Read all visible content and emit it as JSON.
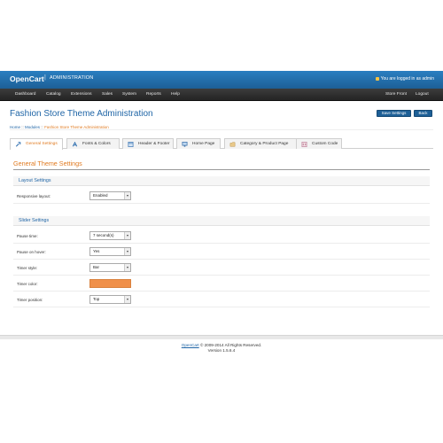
{
  "header": {
    "brand": "OpenCart",
    "separator": "|",
    "admin_label": "ADMINISTRATION",
    "logged_in": "You are logged in as admin"
  },
  "nav": {
    "items": [
      "Dashboard",
      "Catalog",
      "Extensions",
      "Sales",
      "System",
      "Reports",
      "Help"
    ],
    "right": [
      "Store Front",
      "Logout"
    ]
  },
  "page": {
    "title": "Fashion Store Theme Administration",
    "save_label": "Save Settings",
    "back_label": "Back"
  },
  "breadcrumb": {
    "home": "Home",
    "sep1": " :: ",
    "modules": "Modules",
    "sep2": " :: ",
    "current": "Fashion Store Theme Administration"
  },
  "tabs": [
    {
      "label": "General Settings",
      "icon": "wrench-icon",
      "active": true
    },
    {
      "label": "Fonts & Colors",
      "icon": "font-icon",
      "active": false
    },
    {
      "label": "Header & Footer",
      "icon": "layout-icon",
      "active": false
    },
    {
      "label": "Home Page",
      "icon": "monitor-icon",
      "active": false
    },
    {
      "label": "Category & Product Page",
      "icon": "folder-icon",
      "active": false
    },
    {
      "label": "Custom Code",
      "icon": "code-icon",
      "active": false
    }
  ],
  "general": {
    "heading": "General Theme Settings",
    "layout": {
      "title": "Layout Settings",
      "responsive_label": "Responsive layout:",
      "responsive_value": "Enabled"
    },
    "slider": {
      "title": "Slider Settings",
      "pause_time_label": "Pause time:",
      "pause_time_value": "7 second(s)",
      "pause_hover_label": "Pause on hover:",
      "pause_hover_value": "Yes",
      "timer_style_label": "Timer style:",
      "timer_style_value": "Bar",
      "timer_color_label": "Timer color:",
      "timer_color_value": "#f0904a",
      "timer_position_label": "Timer position:",
      "timer_position_value": "Top"
    }
  },
  "footer": {
    "link": "OpenCart",
    "copyright": " © 2009-2014 All Rights Reserved.",
    "version": "Version 1.5.6.4"
  },
  "colors": {
    "accent_blue": "#1f65a6",
    "accent_orange": "#e07b22",
    "header_blue": "#2a7fc1",
    "nav_dark": "#2c2c2c"
  }
}
